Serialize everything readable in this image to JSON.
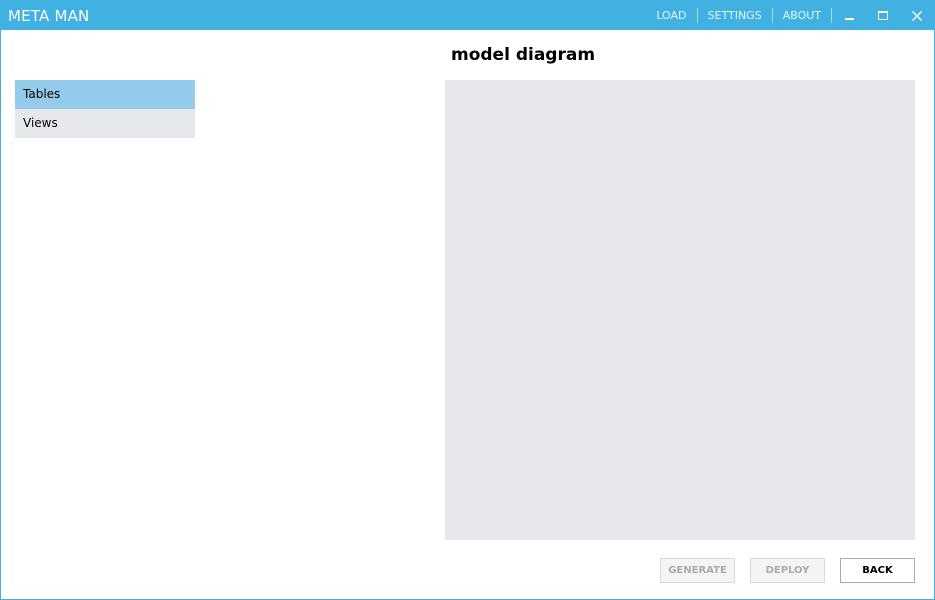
{
  "window": {
    "title": "META MAN",
    "accent_color": "#41b1e1"
  },
  "nav": {
    "load": "LOAD",
    "settings": "SETTINGS",
    "about": "ABOUT"
  },
  "window_controls": {
    "minimize_icon": "minimize-icon",
    "maximize_icon": "maximize-icon",
    "close_icon": "close-icon"
  },
  "main": {
    "title": "model diagram"
  },
  "sidebar": {
    "items": [
      {
        "label": "Tables",
        "selected": true
      },
      {
        "label": "Views",
        "selected": false
      }
    ],
    "selected_color": "#95cbea",
    "item_color": "#e7e8eb"
  },
  "actions": {
    "generate": "GENERATE",
    "deploy": "DEPLOY",
    "back": "BACK"
  }
}
